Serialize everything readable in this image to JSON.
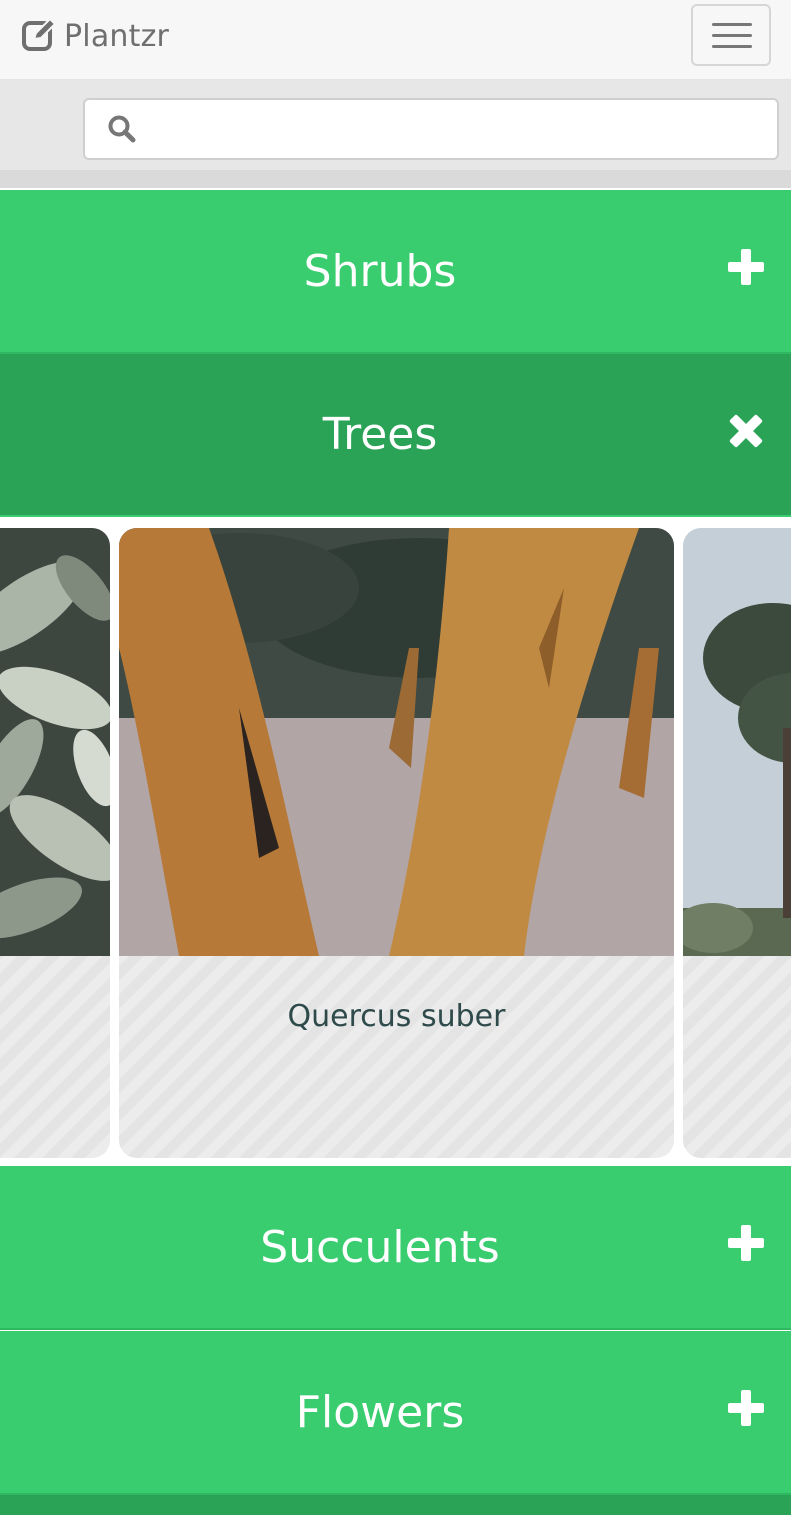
{
  "app": {
    "brand_name": "Plantzr",
    "brand_icon": "edit-icon",
    "menu_icon": "hamburger-icon"
  },
  "search": {
    "placeholder": "",
    "value": "",
    "icon": "search-icon"
  },
  "categories": [
    {
      "label": "Shrubs",
      "state": "collapsed",
      "icon": "plus-icon"
    },
    {
      "label": "Trees",
      "state": "expanded",
      "icon": "close-icon"
    },
    {
      "label": "Succulents",
      "state": "collapsed",
      "icon": "plus-icon"
    },
    {
      "label": "Flowers",
      "state": "collapsed",
      "icon": "plus-icon"
    }
  ],
  "trees": {
    "cards": [
      {
        "caption": "",
        "image": "rubber-plant-leaves-photo"
      },
      {
        "caption": "Quercus suber",
        "image": "cork-oak-trunks-photo"
      },
      {
        "caption": "",
        "image": "tree-against-sky-photo"
      }
    ]
  },
  "colors": {
    "accent_green": "#39cd70",
    "accent_green_dark": "#2aa357",
    "navbar_bg": "#f7f7f7",
    "caption_text": "#2e4a4a"
  }
}
